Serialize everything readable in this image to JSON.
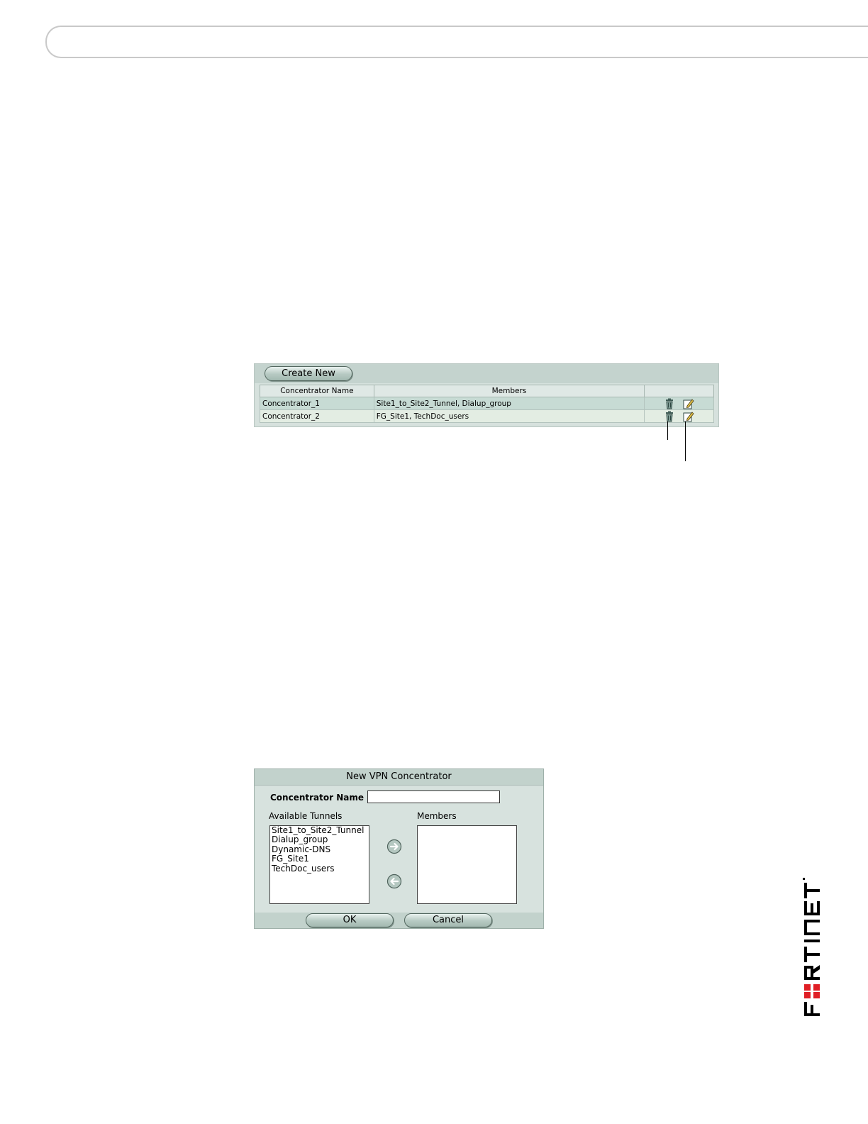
{
  "list_panel": {
    "create_new_label": "Create New",
    "columns": [
      "Concentrator Name",
      "Members",
      ""
    ],
    "rows": [
      {
        "name": "Concentrator_1",
        "members": "Site1_to_Site2_Tunnel, Dialup_group"
      },
      {
        "name": "Concentrator_2",
        "members": "FG_Site1, TechDoc_users"
      }
    ],
    "icons": {
      "delete": "trash-icon",
      "edit": "pencil-icon"
    }
  },
  "dialog": {
    "title": "New VPN Concentrator",
    "name_label": "Concentrator Name",
    "name_value": "",
    "available_label": "Available Tunnels",
    "members_label": "Members",
    "available_tunnels": [
      "Site1_to_Site2_Tunnel",
      "Dialup_group",
      "Dynamic-DNS",
      "FG_Site1",
      "TechDoc_users"
    ],
    "members": [],
    "ok_label": "OK",
    "cancel_label": "Cancel",
    "icons": {
      "add": "arrow-right-icon",
      "remove": "arrow-left-icon"
    }
  },
  "logo": {
    "text": "FORTINET",
    "accent_color": "#e01e25"
  }
}
